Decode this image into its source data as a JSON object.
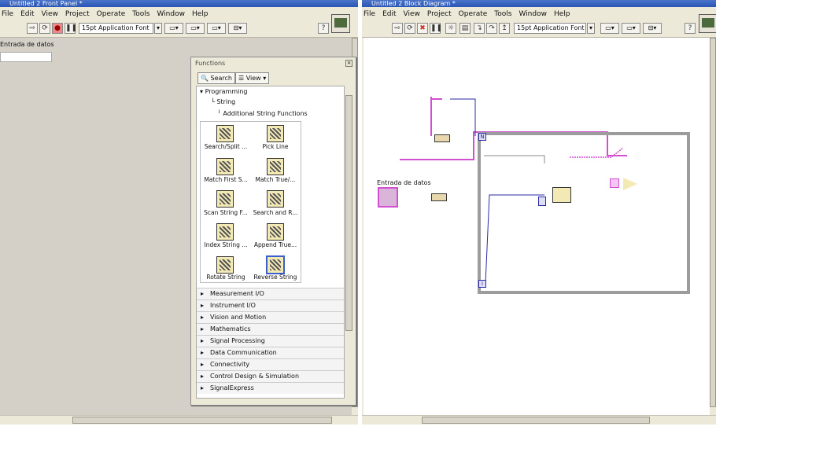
{
  "front_panel": {
    "title": "Untitled 2 Front Panel *",
    "menu": [
      "File",
      "Edit",
      "View",
      "Project",
      "Operate",
      "Tools",
      "Window",
      "Help"
    ],
    "font_selector": "15pt Application Font",
    "control_label": "Entrada de datos"
  },
  "block_diagram": {
    "title": "Untitled 2 Block Diagram *",
    "menu": [
      "File",
      "Edit",
      "View",
      "Project",
      "Operate",
      "Tools",
      "Window",
      "Help"
    ],
    "font_selector": "15pt Application Font",
    "terminal_label": "Entrada de datos",
    "count_terminal": "N",
    "iteration_terminal": "i"
  },
  "palette": {
    "title": "Functions",
    "search_label": "Search",
    "view_label": "View",
    "tree": [
      "Programming",
      "String",
      "Additional String Functions"
    ],
    "functions": [
      "Search/Split ...",
      "Pick Line",
      "Match First S...",
      "Match True/...",
      "Scan String F...",
      "Search and R...",
      "Index String ...",
      "Append True...",
      "Rotate String",
      "Reverse String"
    ],
    "categories": [
      "Measurement I/O",
      "Instrument I/O",
      "Vision and Motion",
      "Mathematics",
      "Signal Processing",
      "Data Communication",
      "Connectivity",
      "Control Design & Simulation",
      "SignalExpress"
    ]
  },
  "colors": {
    "string_wire": "#d24fd2",
    "numeric_wire": "#2a2aa8",
    "title_bar": "#2a55b5"
  }
}
